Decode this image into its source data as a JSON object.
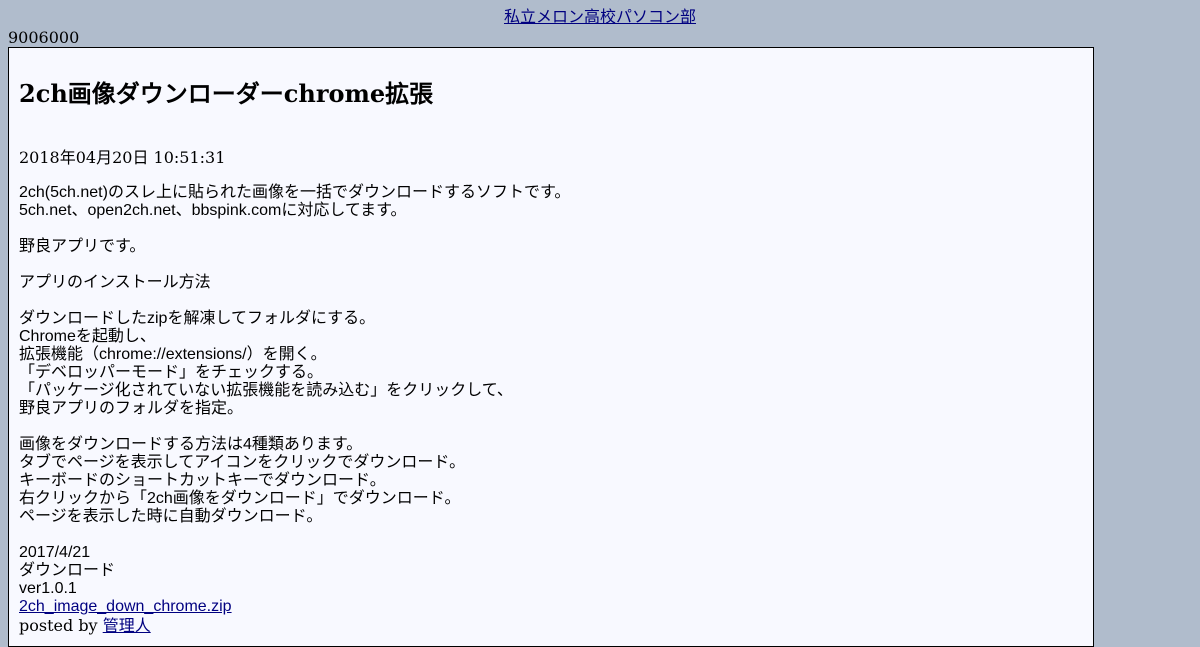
{
  "header": {
    "site_link": "私立メロン高校パソコン部"
  },
  "counter": "9006000",
  "article": {
    "title": "2ch画像ダウンローダーchrome拡張",
    "date": "2018年04月20日 10:51:31",
    "intro": [
      "2ch(5ch.net)のスレ上に貼られた画像を一括でダウンロードするソフトです。",
      "5ch.net、open2ch.net、bbspink.comに対応してます。"
    ],
    "note": "野良アプリです。",
    "install_heading": "アプリのインストール方法",
    "install_steps": [
      "ダウンロードしたzipを解凍してフォルダにする。",
      "Chromeを起動し、",
      "拡張機能（chrome://extensions/）を開く。",
      "「デベロッパーモード」をチェックする。",
      "「パッケージ化されていない拡張機能を読み込む」をクリックして、",
      "野良アプリのフォルダを指定。"
    ],
    "methods": [
      "画像をダウンロードする方法は4種類あります。",
      "タブでページを表示してアイコンをクリックでダウンロード。",
      "キーボードのショートカットキーでダウンロード。",
      "右クリックから「2ch画像をダウンロード」でダウンロード。",
      "ページを表示した時に自動ダウンロード。"
    ],
    "release_date": "2017/4/21",
    "download_label": "ダウンロード",
    "version": "ver1.0.1",
    "download_file": "2ch_image_down_chrome.zip",
    "posted_by_prefix": "posted by",
    "author": "管理人"
  }
}
